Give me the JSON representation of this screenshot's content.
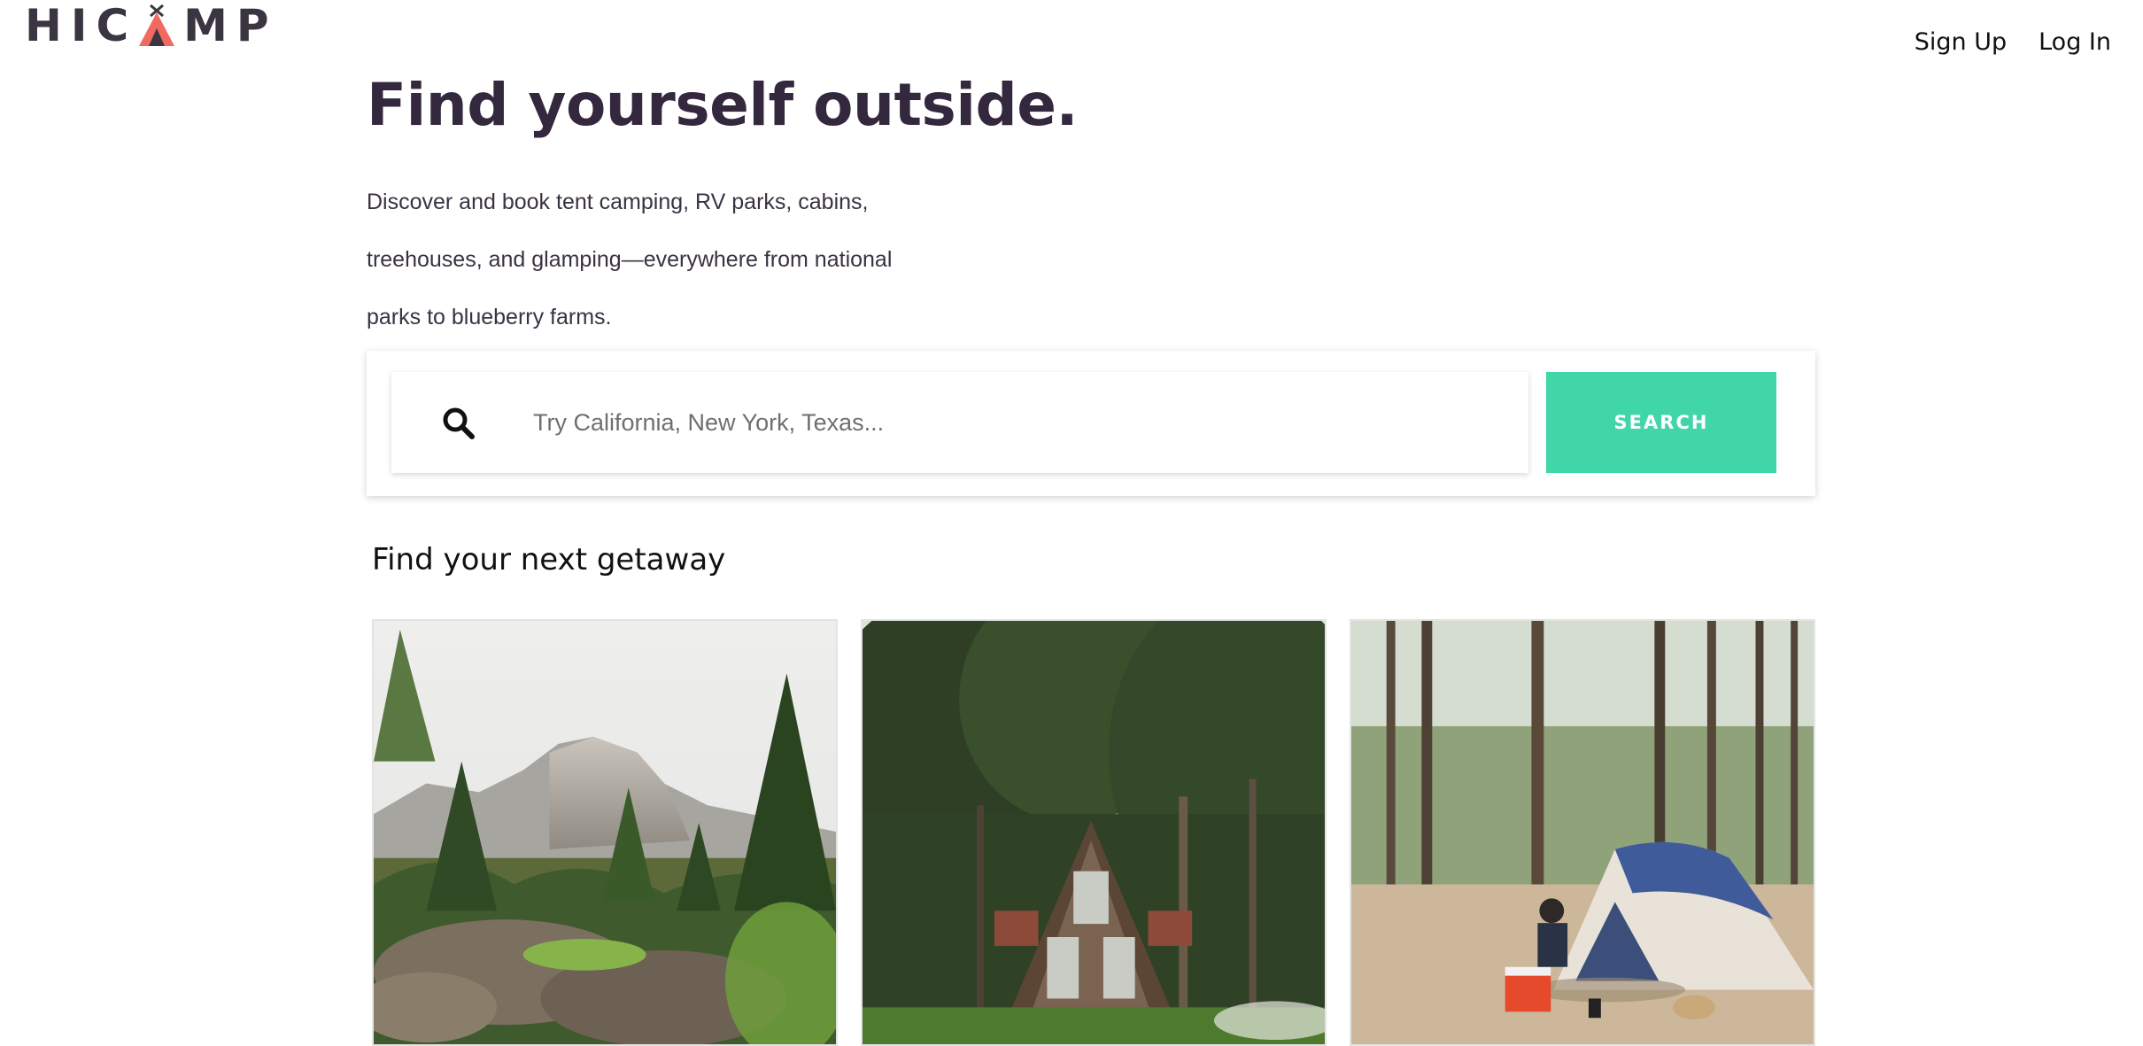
{
  "header": {
    "logo": "HICAMP",
    "logo_left": "HIC",
    "logo_right": "MP",
    "nav": {
      "signup": "Sign Up",
      "login": "Log In"
    }
  },
  "hero": {
    "title": "Find yourself outside.",
    "lines": [
      "Discover and book tent camping, RV parks, cabins,",
      "treehouses, and glamping—everywhere from national",
      "parks to blueberry farms."
    ]
  },
  "search": {
    "icon": "search-icon",
    "placeholder": "Try California, New York, Texas...",
    "value": "",
    "button_label": "SEARCH"
  },
  "getaway": {
    "title": "Find your next getaway",
    "cards": [
      {
        "image": "rocky-mountain-pine-forest-photo"
      },
      {
        "image": "a-frame-cabin-in-forest-photo"
      },
      {
        "image": "tent-camping-in-pine-forest-photo"
      }
    ]
  },
  "colors": {
    "accent": "#40d6a8",
    "logo_tent": "#f06a5f",
    "heading": "#33283d"
  }
}
